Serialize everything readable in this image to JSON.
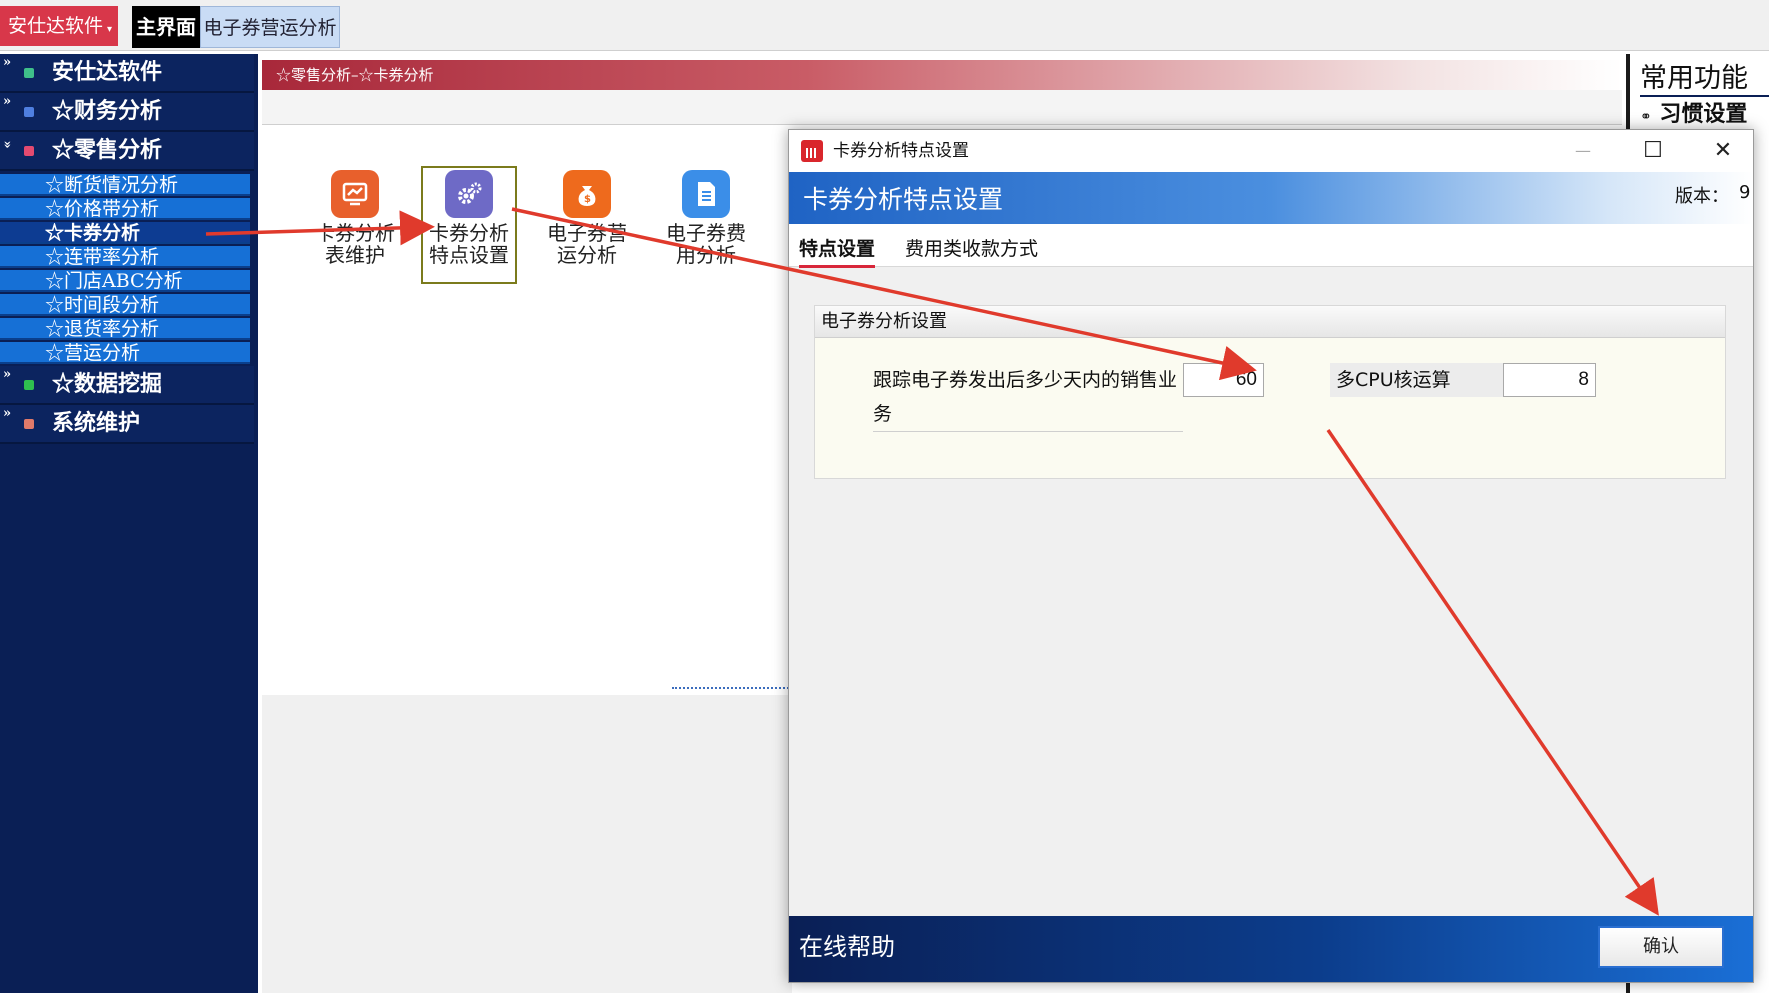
{
  "topbar": {
    "brand": "安仕达软件",
    "brand_caret": "▾",
    "tabs": [
      {
        "label": "主界面"
      },
      {
        "label": "电子券营运分析"
      }
    ]
  },
  "sidebar": {
    "items": [
      {
        "label": "安仕达软件",
        "icon_color": "#3fbf8a"
      },
      {
        "label": "☆财务分析",
        "icon_color": "#4f7fe0"
      },
      {
        "label": "☆零售分析",
        "icon_color": "#e34a70"
      },
      {
        "label": "☆数据挖掘",
        "icon_color": "#2fbf4f"
      },
      {
        "label": "系统维护",
        "icon_color": "#e07a6a"
      }
    ],
    "chev_collapsed": "»",
    "chev_expanded": "»",
    "sub_items": [
      {
        "label": "☆断货情况分析"
      },
      {
        "label": "☆价格带分析"
      },
      {
        "label": "☆卡券分析"
      },
      {
        "label": "☆连带率分析"
      },
      {
        "label": "☆门店ABC分析"
      },
      {
        "label": "☆时间段分析"
      },
      {
        "label": "☆退货率分析"
      },
      {
        "label": "☆营运分析"
      }
    ]
  },
  "center": {
    "breadcrumb": "☆零售分析–☆卡券分析",
    "tools": [
      {
        "line1": "卡券分析",
        "line2": "表维护",
        "color": "#e8602c"
      },
      {
        "line1": "卡券分析",
        "line2": "特点设置",
        "color": "#6e6ac6"
      },
      {
        "line1": "电子券营",
        "line2": "运分析",
        "color": "#ee6a1d"
      },
      {
        "line1": "电子券费",
        "line2": "用分析",
        "color": "#3b8ee8"
      }
    ]
  },
  "right_panel": {
    "title": "常用功能",
    "habit": "习惯设置"
  },
  "dialog": {
    "title": "卡券分析特点设置",
    "banner_title": "卡券分析特点设置",
    "version_label": "版本：",
    "version_value": "9",
    "tabs": [
      {
        "label": "特点设置"
      },
      {
        "label": "费用类收款方式"
      }
    ],
    "group_title": "电子券分析设置",
    "fields": {
      "track_days_label": "跟踪电子券发出后多少天内的销售业务",
      "track_days_value": "60",
      "cpu_label": "多CPU核运算",
      "cpu_value": "8"
    },
    "footer_help": "在线帮助",
    "confirm_label": "确认",
    "win_min": "—",
    "win_max": "☐",
    "win_close": "✕"
  },
  "colors": {
    "annotation_arrow": "#e03a2c",
    "sidebar_bg": "#0a1f55",
    "sub_item_bg": "#1670d6"
  }
}
